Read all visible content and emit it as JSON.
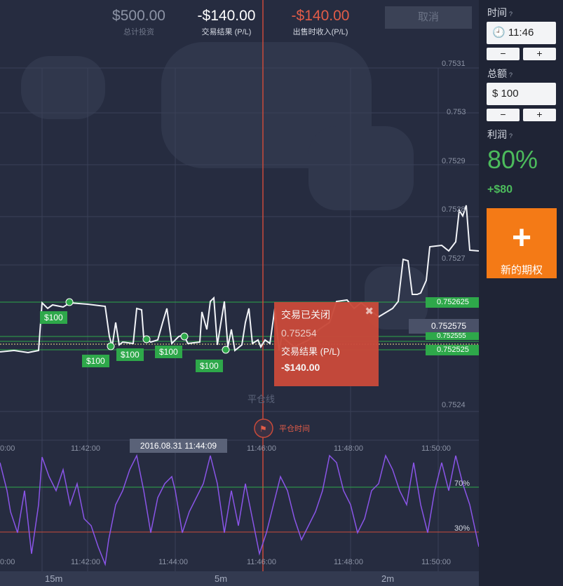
{
  "header": {
    "total_invest_value": "$500.00",
    "total_invest_label": "总计投资",
    "trade_result_value": "-$140.00",
    "trade_result_label": "交易结果 (P/L)",
    "sell_income_value": "-$140.00",
    "sell_income_label": "出售时收入(P/L)",
    "cancel_label": "取消"
  },
  "sidebar": {
    "time_label": "时间",
    "time_value": "11:46",
    "amount_label": "总额",
    "amount_currency": "$",
    "amount_value": "100",
    "minus": "−",
    "plus": "+",
    "profit_label": "利润",
    "profit_pct": "80%",
    "profit_amount": "+$80",
    "new_option_label": "新的期权",
    "help_mark": "?"
  },
  "chart": {
    "price_ticks": [
      "0.7531",
      "0.753",
      "0.7529",
      "0.7528",
      "0.7527",
      "0.7524"
    ],
    "price_tags": {
      "green_top": "0.752625",
      "current": "0.752575",
      "green_mid": "0.752555",
      "green_low": "0.752525"
    },
    "trade_labels": [
      "$100",
      "$100",
      "$100",
      "$100",
      "$100"
    ],
    "close_line_label": "平仓线",
    "close_time_label": "平仓时间",
    "time_ticks": [
      "0:00",
      "11:42:00",
      "11:44:00",
      "11:46:00",
      "11:48:00",
      "11:50:00"
    ],
    "cursor_time": "2016.08.31 11:44:09",
    "rsi_levels": [
      "70%",
      "30%"
    ],
    "timeframes": [
      "15m",
      "5m",
      "2m"
    ],
    "colors": {
      "green": "#2ea84a",
      "red": "#c94a3a",
      "rsi": "#8a55e8",
      "orange": "#f47a16"
    }
  },
  "trade_box": {
    "title": "交易已关闭",
    "price": "0.75254",
    "result_label": "交易结果 (P/L)",
    "result_value": "-$140.00",
    "close_icon": "close-icon"
  }
}
